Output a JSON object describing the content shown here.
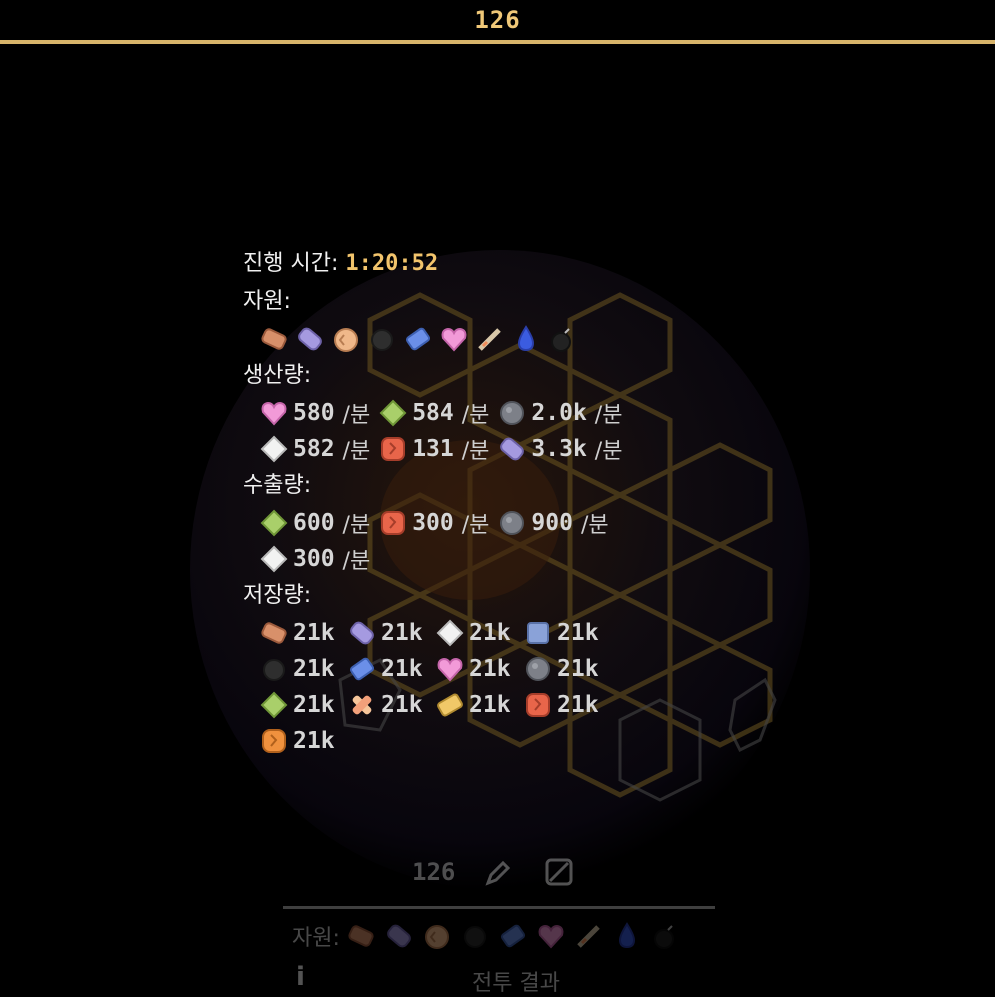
{
  "header": {
    "title": "126"
  },
  "panel": {
    "elapsed_label": "진행 시간:",
    "elapsed_value": "1:20:52",
    "resources_label": "자원:",
    "resource_icons": [
      "copper-bar-icon",
      "purple-bar-icon",
      "peach-ore-icon",
      "coal-icon",
      "blue-crystal-icon",
      "heart-gem-icon",
      "feather-icon",
      "water-drop-icon",
      "bomb-icon"
    ],
    "production_label": "생산량:",
    "production": [
      [
        {
          "icon": "heart-gem-icon",
          "value": "580",
          "unit": "/분"
        },
        {
          "icon": "green-gem-icon",
          "value": "584",
          "unit": "/분"
        },
        {
          "icon": "stone-icon",
          "value": "2.0k",
          "unit": "/분"
        }
      ],
      [
        {
          "icon": "white-crystal-icon",
          "value": "582",
          "unit": "/분"
        },
        {
          "icon": "red-ore-icon",
          "value": " 131",
          "unit": "/분"
        },
        {
          "icon": "purple-bar-icon",
          "value": "3.3k",
          "unit": "/분"
        }
      ]
    ],
    "export_label": "수출량:",
    "exports": [
      [
        {
          "icon": "green-gem-icon",
          "value": "600",
          "unit": "/분"
        },
        {
          "icon": "red-ore-icon",
          "value": "300",
          "unit": "/분"
        },
        {
          "icon": "stone-icon",
          "value": "900",
          "unit": "/분"
        }
      ],
      [
        {
          "icon": "white-crystal-icon",
          "value": "300",
          "unit": "/분"
        }
      ]
    ],
    "storage_label": "저장량:",
    "storage": [
      [
        {
          "icon": "copper-bar-icon",
          "value": "21k"
        },
        {
          "icon": "purple-bar-icon",
          "value": "21k"
        },
        {
          "icon": "white-crystal-icon",
          "value": "21k"
        },
        {
          "icon": "blue-cube-icon",
          "value": "21k"
        }
      ],
      [
        {
          "icon": "coal-icon",
          "value": "21k"
        },
        {
          "icon": "blue-crystal-icon",
          "value": "21k"
        },
        {
          "icon": "heart-gem-icon",
          "value": "21k"
        },
        {
          "icon": "stone-icon",
          "value": "21k"
        }
      ],
      [
        {
          "icon": "green-gem-icon",
          "value": "21k"
        },
        {
          "icon": "bandage-icon",
          "value": "21k"
        },
        {
          "icon": "gold-bar-icon",
          "value": "21k"
        },
        {
          "icon": "red-ore-icon",
          "value": "21k"
        }
      ],
      [
        {
          "icon": "orange-ore-icon",
          "value": "21k"
        }
      ]
    ]
  },
  "bottom": {
    "count": "126",
    "resources_label": "자원:",
    "battle_result": "전투 결과"
  },
  "colors": {
    "accent": "#f2c46c",
    "top_line": "#d8b46a",
    "background": "#000000"
  }
}
